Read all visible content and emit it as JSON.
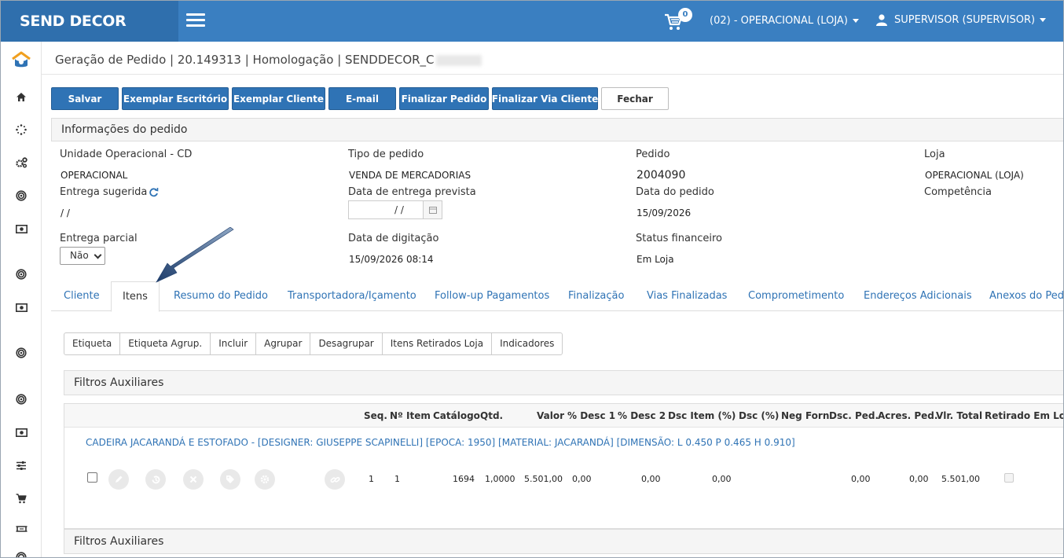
{
  "brand": "SEND DECOR",
  "topbar": {
    "cart_count": "0",
    "unit": "(02) - OPERACIONAL (LOJA)",
    "user": "SUPERVISOR (SUPERVISOR)"
  },
  "page": {
    "title": "Geração de Pedido | 20.149313 | Homologação | SENDDECOR_C"
  },
  "toolbar": {
    "save": "Salvar",
    "office_copy": "Exemplar Escritório",
    "client_copy": "Exemplar Cliente",
    "email": "E-mail",
    "finish": "Finalizar Pedido",
    "finish_client": "Finalizar Via Cliente",
    "close": "Fechar"
  },
  "info": {
    "heading": "Informações do pedido",
    "unit_label": "Unidade Operacional - CD",
    "unit_value": "OPERACIONAL",
    "type_label": "Tipo de pedido",
    "type_value": "VENDA DE MERCADORIAS",
    "order_label": "Pedido",
    "order_value": "2004090",
    "store_label": "Loja",
    "store_value": "OPERACIONAL (LOJA)",
    "suggested_label": "Entrega sugerida",
    "suggested_value": "/ /",
    "expected_label": "Data de entrega prevista",
    "expected_value": "/ /",
    "order_date_label": "Data do pedido",
    "order_date_value": "15/09/2026",
    "competence_label": "Competência",
    "partial_label": "Entrega parcial",
    "partial_value": "Não",
    "typing_label": "Data de digitação",
    "typing_value": "15/09/2026 08:14",
    "fin_status_label": "Status financeiro",
    "fin_status_value": "Em Loja"
  },
  "tabs": [
    "Cliente",
    "Itens",
    "Resumo do Pedido",
    "Transportadora/Içamento",
    "Follow-up Pagamentos",
    "Finalização",
    "Vias Finalizadas",
    "Comprometimento",
    "Endereços Adicionais",
    "Anexos do Pedido"
  ],
  "items_toolbar": [
    "Etiqueta",
    "Etiqueta Agrup.",
    "Incluir",
    "Agrupar",
    "Desagrupar",
    "Itens Retirados Loja",
    "Indicadores"
  ],
  "filters_label": "Filtros Auxiliares",
  "grid": {
    "columns": [
      "Seq.",
      "Nº Item",
      "Catálogo",
      "Qtd.",
      "Valor",
      "% Desc 1",
      "% Desc 2",
      "Dsc Item (%)",
      "Dsc (%)",
      "Neg Forn",
      "Dsc. Ped.",
      "Acres. Ped.",
      "Vlr. Total",
      "Retirado Em Loja"
    ],
    "item_description": "CADEIRA JACARANDÁ E ESTOFADO - [DESIGNER: GIUSEPPE SCAPINELLI] [EPOCA: 1950] [MATERIAL: JACARANDÁ] [DIMENSÃO: L 0.450 P 0.465 H 0.910]",
    "row": {
      "seq": "1",
      "item": "1",
      "catalog": "1694",
      "qty": "1,0000",
      "value": "5.501,00",
      "desc1": "0,00",
      "desc2": "0,00",
      "desc_item": "0,00",
      "desc_ped": "0,00",
      "acres_ped": "0,00",
      "total": "5.501,00"
    }
  }
}
